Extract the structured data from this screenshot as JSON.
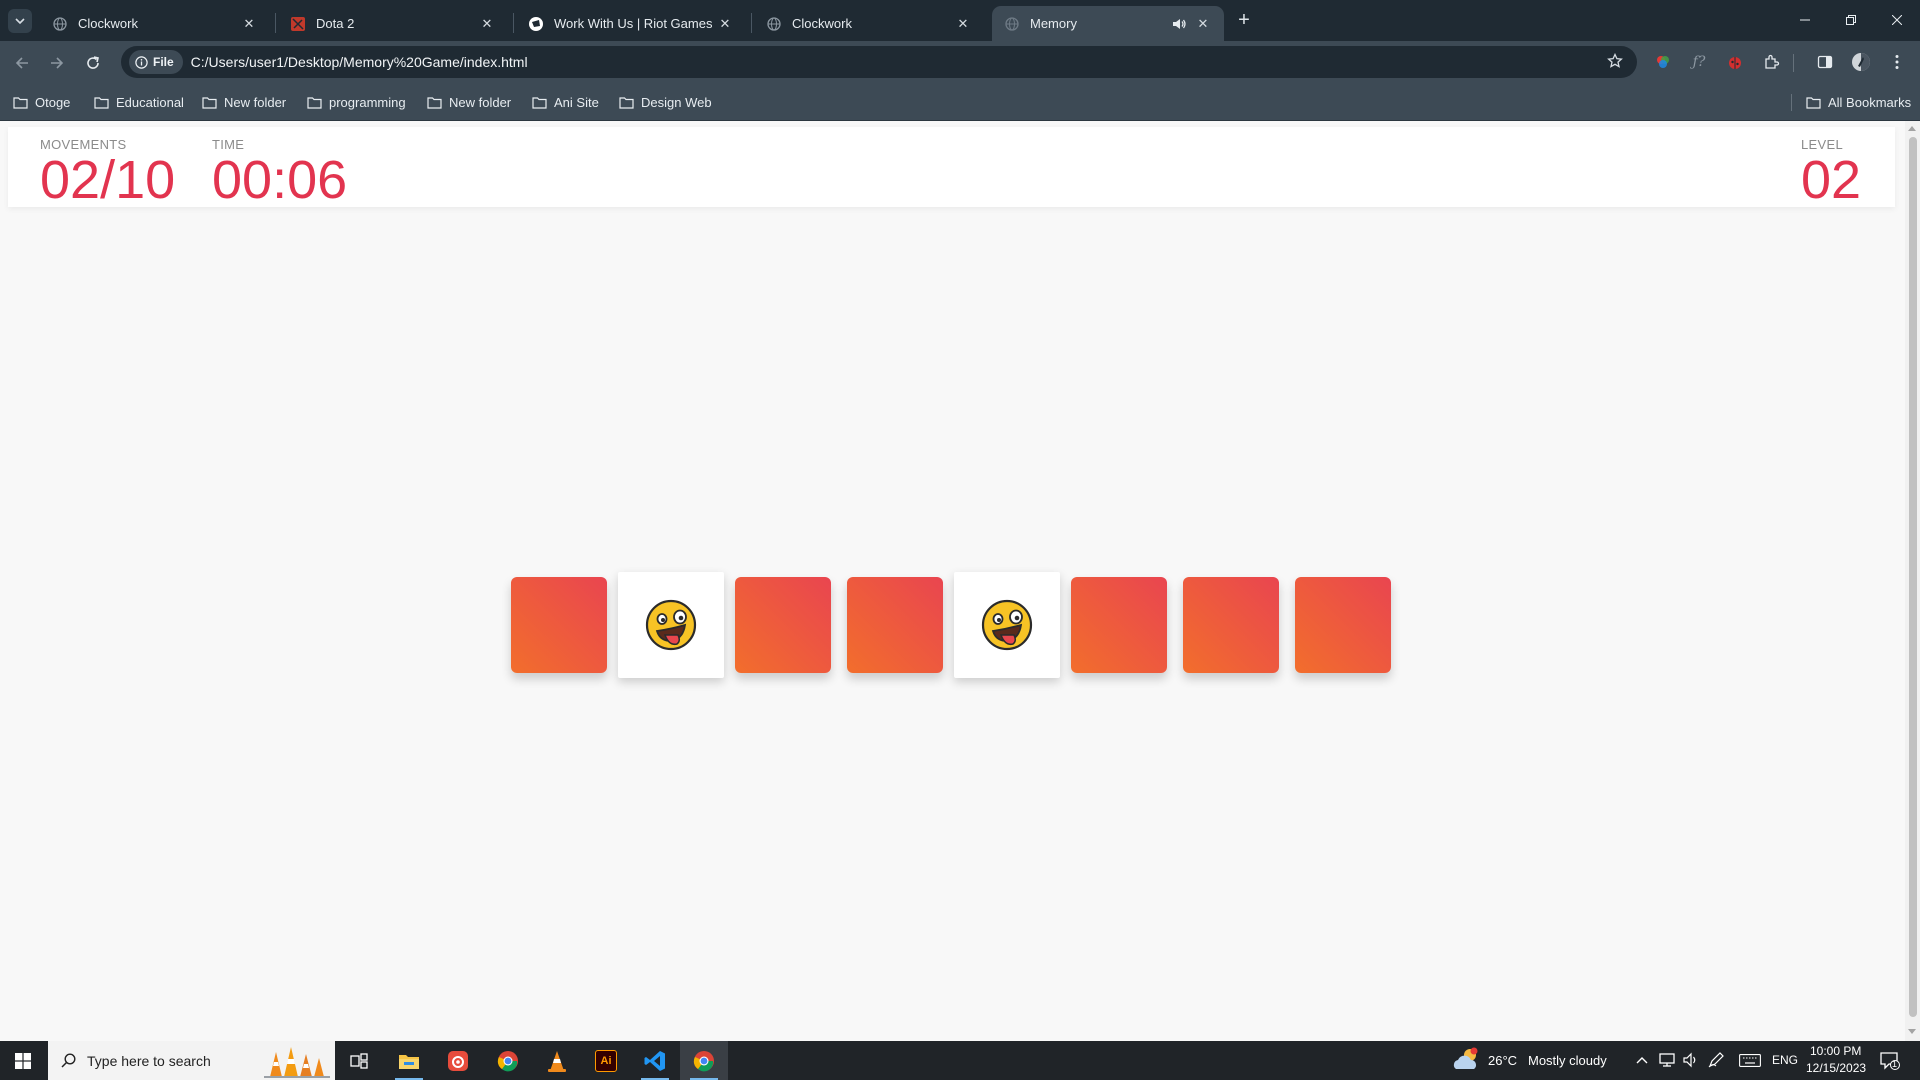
{
  "browser": {
    "tabs": [
      {
        "title": "Clockwork",
        "favicon": "globe-icon"
      },
      {
        "title": "Dota 2",
        "favicon": "dota-icon"
      },
      {
        "title": "Work With Us | Riot Games",
        "favicon": "riot-icon"
      },
      {
        "title": "Clockwork",
        "favicon": "globe-icon"
      },
      {
        "title": "Memory",
        "favicon": "globe-icon",
        "active": true,
        "audio": true
      }
    ],
    "address": {
      "chip": "File",
      "url": "C:/Users/user1/Desktop/Memory%20Game/index.html"
    },
    "bookmarks": [
      "Otoge",
      "Educational",
      "New folder",
      "programming",
      "New folder",
      "Ani Site",
      "Design Web"
    ],
    "all_bookmarks": "All Bookmarks"
  },
  "game": {
    "movements": {
      "label": "MOVEMENTS",
      "value": "02/10"
    },
    "time": {
      "label": "TIME",
      "value": "00:06"
    },
    "level": {
      "label": "LEVEL",
      "value": "02"
    },
    "cards": [
      {
        "state": "face-down"
      },
      {
        "state": "face-up",
        "emoji": "zany-face"
      },
      {
        "state": "face-down"
      },
      {
        "state": "face-down"
      },
      {
        "state": "face-up",
        "emoji": "zany-face"
      },
      {
        "state": "face-down"
      },
      {
        "state": "face-down"
      },
      {
        "state": "face-down"
      }
    ],
    "colors": {
      "accent": "#e2344f",
      "card_gradient_start": "#f26e2c",
      "card_gradient_end": "#e94550"
    }
  },
  "taskbar": {
    "search_placeholder": "Type here to search",
    "weather": {
      "temp": "26°C",
      "condition": "Mostly cloudy"
    },
    "language": "ENG",
    "time": "10:00 PM",
    "date": "12/15/2023",
    "notifications": "1"
  }
}
